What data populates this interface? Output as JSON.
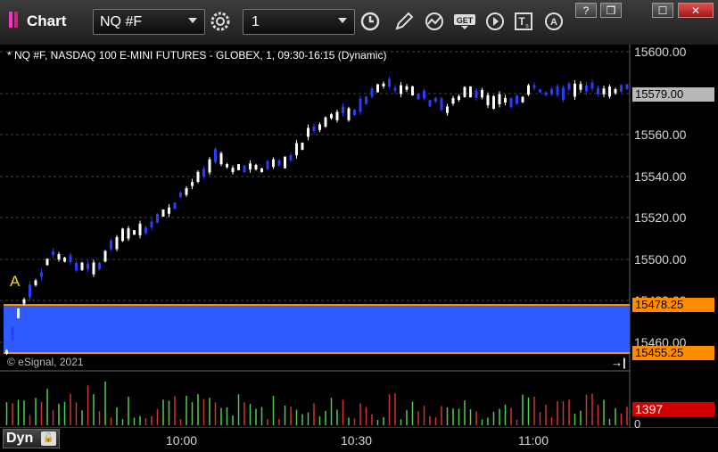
{
  "window": {
    "title": "Chart"
  },
  "toolbar": {
    "symbol": "NQ #F",
    "interval": "1",
    "icons": [
      "gear-icon",
      "clock-icon",
      "pencil-icon",
      "study-icon",
      "get-icon",
      "play-icon",
      "text-icon",
      "alert-icon"
    ]
  },
  "window_buttons": {
    "help": "?",
    "restore": "❐",
    "maximize": "☐",
    "close": "✕"
  },
  "price_pane": {
    "title": "* NQ #F, NASDAQ 100 E-MINI FUTURES - GLOBEX, 1, 09:30-16:15 (Dynamic)",
    "y_labels": [
      "15600.00",
      "15579.00",
      "15560.00",
      "15540.00",
      "15520.00",
      "15500.00",
      "15480.00",
      "15460.00"
    ],
    "last_price": "15579.00",
    "zone_high": "15478.25",
    "zone_low": "15455.25",
    "marker": "A",
    "copyright": "© eSignal, 2021"
  },
  "volume_pane": {
    "last_volume": "1397",
    "zero_label": "0"
  },
  "time_axis": {
    "labels": [
      "10:00",
      "10:30",
      "11:00"
    ],
    "dyn_label": "Dyn"
  },
  "colors": {
    "up": "#ffffff",
    "down": "#2b3bff",
    "zone": "#2f5bff",
    "zone_border": "#ff8c00",
    "vol_up": "#4ccf4c",
    "vol_down": "#d43333",
    "accent": "#ff8c00"
  }
}
